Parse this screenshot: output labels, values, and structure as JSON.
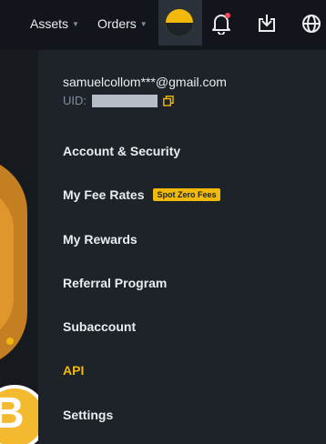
{
  "topbar": {
    "assets_label": "Assets",
    "orders_label": "Orders"
  },
  "colors": {
    "accent": "#f0b90b",
    "background": "#0b0e11",
    "menu_background": "#1e2329",
    "text": "#eaecef",
    "muted": "#848e9c",
    "notification": "#f6465d"
  },
  "icons": {
    "avatar": "avatar-icon",
    "notifications": "bell-icon",
    "download": "download-icon",
    "language": "globe-icon",
    "copy": "copy-icon"
  },
  "account": {
    "email": "samuelcollom***@gmail.com",
    "uid_label": "UID:"
  },
  "menu": {
    "items": [
      {
        "label": "Account & Security"
      },
      {
        "label": "My Fee Rates",
        "badge": "Spot Zero Fees"
      },
      {
        "label": "My Rewards"
      },
      {
        "label": "Referral Program"
      },
      {
        "label": "Subaccount"
      },
      {
        "label": "API",
        "active": true
      },
      {
        "label": "Settings"
      }
    ]
  }
}
